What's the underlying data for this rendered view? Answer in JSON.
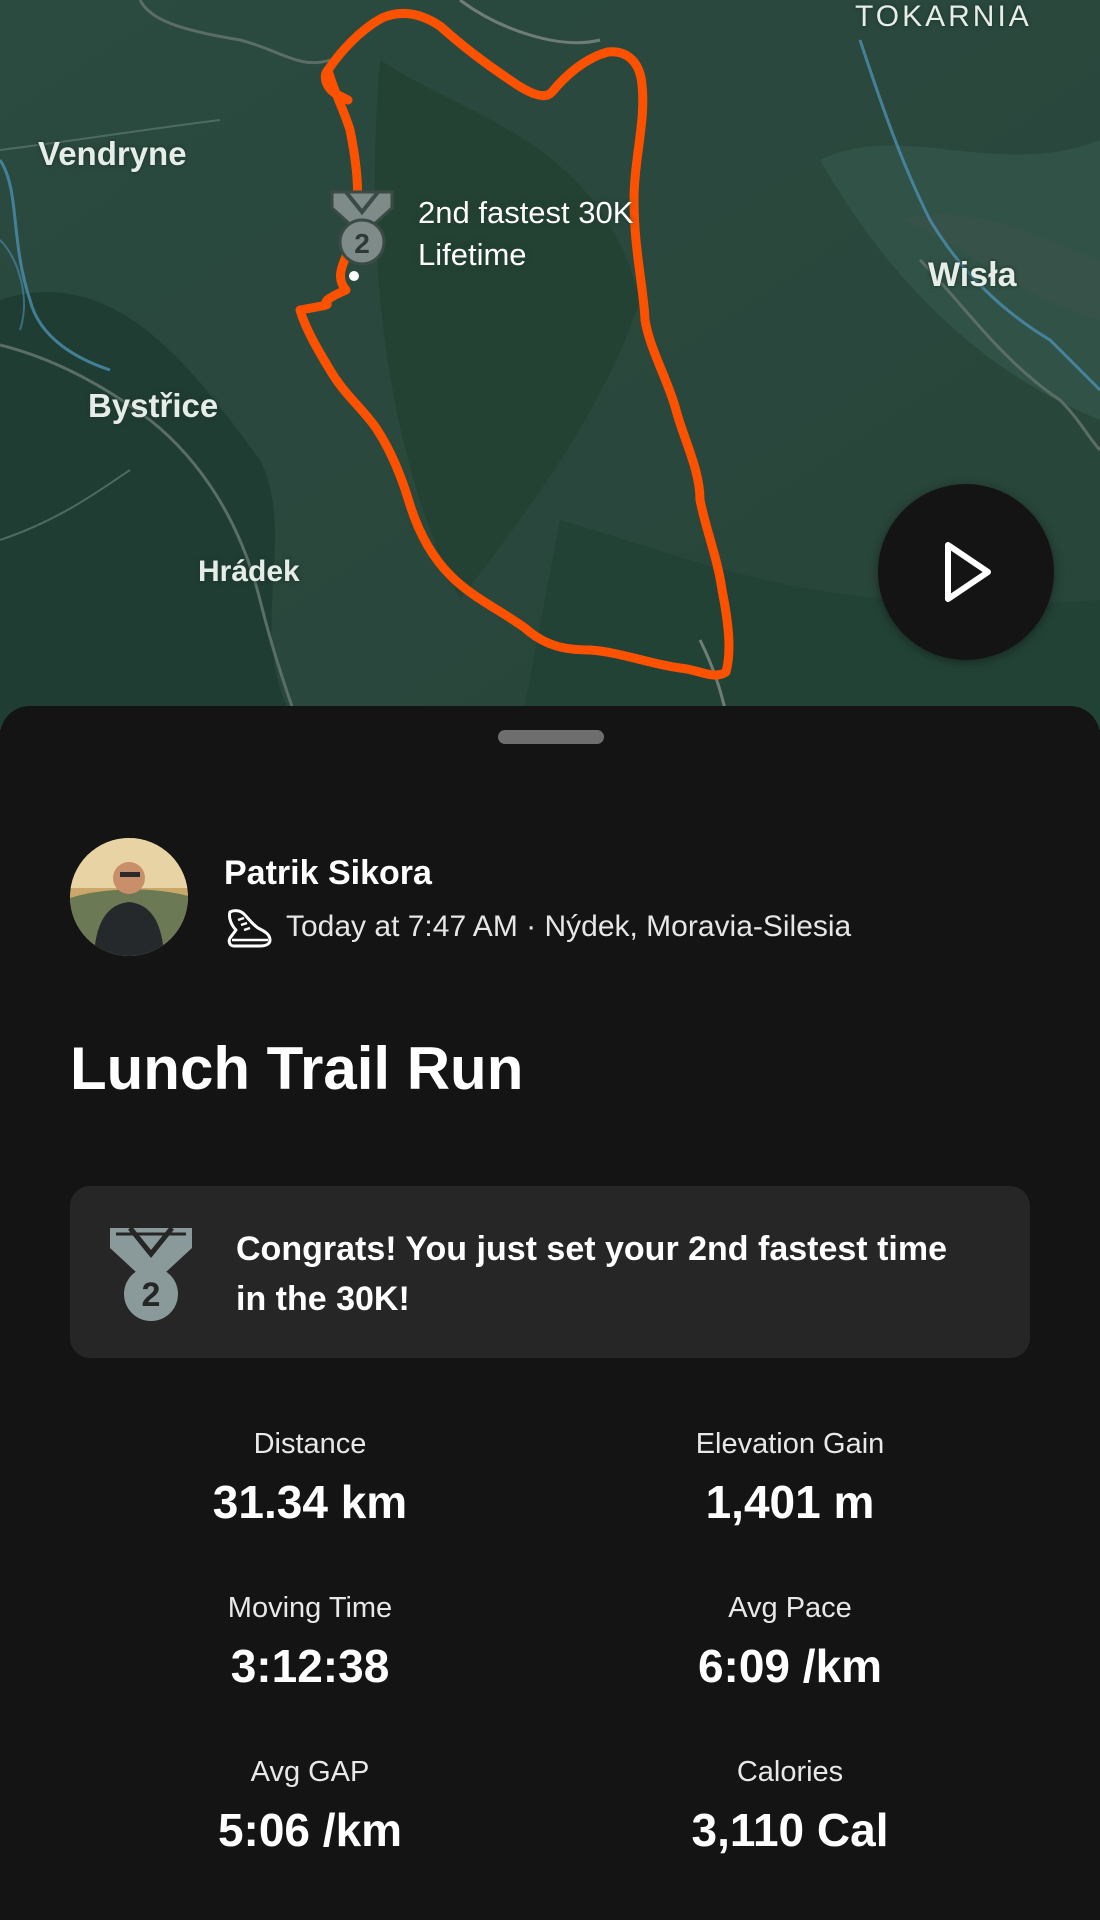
{
  "map": {
    "places": {
      "vendryne": "Vendryne",
      "bystrice": "Bystřice",
      "hradek": "Hrádek",
      "wisla": "Wisła",
      "tokarnia": "TOKARNIA"
    },
    "pr_badge_number": "2",
    "pr_label_line1": "2nd fastest 30K",
    "pr_label_line2": "Lifetime",
    "route_color": "#fc5200",
    "play_icon": "play-icon"
  },
  "athlete": {
    "name": "Patrik Sikora",
    "activity_icon": "running-shoe-icon",
    "meta": "Today at 7:47 AM · Nýdek, Moravia-Silesia"
  },
  "activity": {
    "title": "Lunch Trail Run"
  },
  "achievement": {
    "icon": "medal-icon",
    "medal_number": "2",
    "message": "Congrats! You just set your 2nd fastest time in the 30K!"
  },
  "stats": [
    {
      "label": "Distance",
      "value": "31.34 km"
    },
    {
      "label": "Elevation Gain",
      "value": "1,401 m"
    },
    {
      "label": "Moving Time",
      "value": "3:12:38"
    },
    {
      "label": "Avg Pace",
      "value": "6:09 /km"
    },
    {
      "label": "Avg GAP",
      "value": "5:06 /km"
    },
    {
      "label": "Calories",
      "value": "3,110 Cal"
    }
  ]
}
